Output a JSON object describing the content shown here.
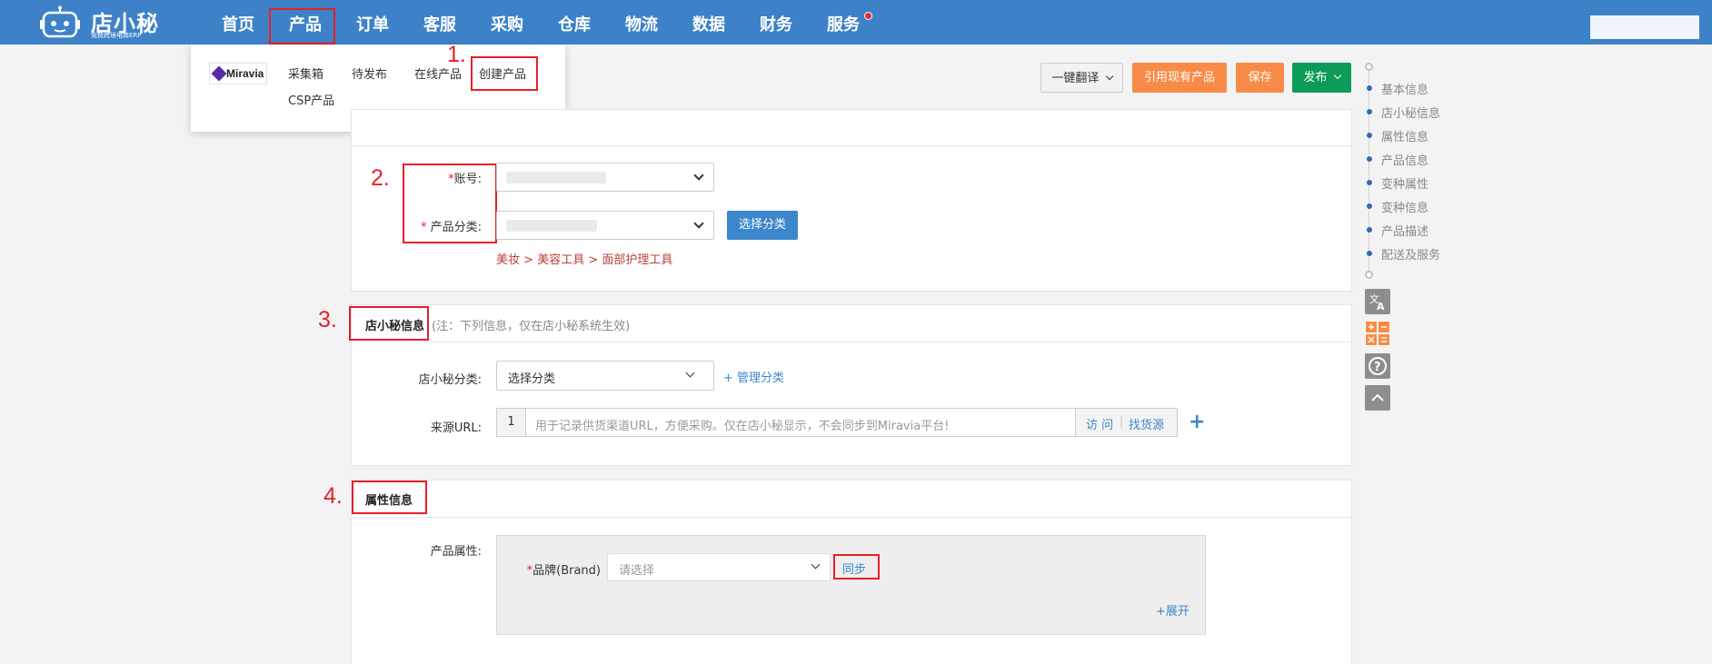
{
  "app": {
    "logo_text": "店小秘",
    "logo_subtitle": "免费跨境电商ERP"
  },
  "nav": {
    "items": [
      "首页",
      "产品",
      "订单",
      "客服",
      "采购",
      "仓库",
      "物流",
      "数据",
      "财务",
      "服务"
    ],
    "active": "产品"
  },
  "dropdown": {
    "brand": "Miravia",
    "items": [
      "采集箱",
      "待发布",
      "在线产品",
      "创建产品",
      "CSP产品"
    ]
  },
  "annotations": [
    "1.",
    "2.",
    "3.",
    "4."
  ],
  "toolbar": {
    "translate_label": "一键翻译",
    "import_label": "引用现有产品",
    "save_label": "保存",
    "publish_label": "发布"
  },
  "basic": {
    "account_label": "账号:",
    "category_label": "产品分类:",
    "select_category_button": "选择分类",
    "breadcrumb": [
      "美妆",
      "美容工具",
      "面部护理工具"
    ]
  },
  "dxm_info": {
    "title": "店小秘信息",
    "note": "(注：下列信息，仅在店小秘系统生效)",
    "category_label": "店小秘分类:",
    "category_value": "选择分类",
    "manage_link": "+ 管理分类",
    "url_label": "来源URL:",
    "url_prefix": "1",
    "url_placeholder": "用于记录供货渠道URL，方便采购。仅在店小秘显示，不会同步到Miravia平台!",
    "visit_label": "访 问",
    "find_source_label": "找货源"
  },
  "attributes": {
    "title": "属性信息",
    "product_attr_label": "产品属性:",
    "brand_label": "品牌(Brand)",
    "brand_placeholder": "请选择",
    "sync_label": "同步",
    "expand_label": "+展开"
  },
  "side_nav": {
    "items": [
      "基本信息",
      "店小秘信息",
      "属性信息",
      "产品信息",
      "变种属性",
      "变种信息",
      "产品描述",
      "配送及服务"
    ]
  },
  "colors": {
    "nav_blue": "#3d82c8",
    "orange": "#f98b48",
    "green": "#0c9c58",
    "link_blue": "#3c86cc",
    "annotation_red": "#e5202a"
  }
}
